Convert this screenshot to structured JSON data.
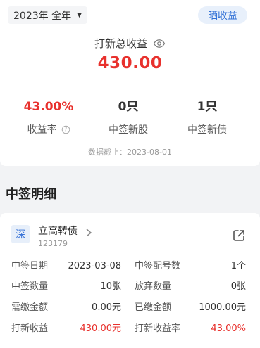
{
  "summary": {
    "period_selector": "2023年 全年",
    "share_button": "晒收益",
    "total_label": "打新总收益",
    "total_value": "430.00",
    "stats": [
      {
        "value": "43.00%",
        "label": "收益率",
        "color": "#e8312d"
      },
      {
        "value": "0只",
        "label": "中签新股"
      },
      {
        "value": "1只",
        "label": "中签新债"
      }
    ],
    "as_of": "数据截止：2023-08-01"
  },
  "section_title": "中签明细",
  "detail": {
    "market_badge": "深",
    "name": "立高转债",
    "code": "123179",
    "rows": [
      {
        "k1": "中签日期",
        "v1": "2023-03-08",
        "k2": "中签配号数",
        "v2": "1个"
      },
      {
        "k1": "中签数量",
        "v1": "10张",
        "k2": "放弃数量",
        "v2": "0张"
      },
      {
        "k1": "需缴金额",
        "v1": "0.00元",
        "k2": "已缴金额",
        "v2": "1000.00元"
      },
      {
        "k1": "打新收益",
        "v1": "430.00元",
        "k2": "打新收益率",
        "v2": "43.00%"
      }
    ]
  },
  "colors": {
    "accent_red": "#e8312d",
    "accent_blue": "#2f6fd6"
  }
}
